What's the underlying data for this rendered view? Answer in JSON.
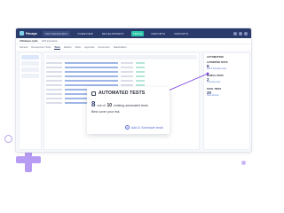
{
  "app": {
    "brand": "Panaya",
    "project": "SAP S4HANA RFC"
  },
  "nav": {
    "items": [
      "OVERVIEW",
      "DEVELOPMENT",
      "TESTS",
      "REPORTS",
      "REPORTS"
    ],
    "active": "TESTS"
  },
  "breadcrumb": {
    "cycle": "3 Release cycle",
    "desc": "UAT scenarios"
  },
  "tabs": [
    "General",
    "Development Tests",
    "Tests",
    "Defects",
    "Risks",
    "Approvals",
    "Documents",
    "Stakeholders"
  ],
  "right_panel": {
    "title": "AUTOMATION",
    "blocks": [
      {
        "label": "AUTOMATED TESTS",
        "number": "8",
        "link": "Add & Schedule tests"
      },
      {
        "label": "MANUAL TESTS",
        "number": "2",
        "link": "Automate tests"
      },
      {
        "label": "TOTAL TESTS",
        "number": "20",
        "link": "View all tests"
      }
    ]
  },
  "callout": {
    "title": "AUTOMATED TESTS",
    "count": "8",
    "out_of": "out of",
    "total": "10",
    "suffix": "existing automated tests",
    "subtitle": "Best cover your risk",
    "action": "Add & Schedule tests",
    "icon": "clipboard-icon",
    "action_icon": "plus-circle-icon"
  },
  "colors": {
    "nav_bg": "#2a3a6b",
    "active_tab": "#29c7a8",
    "accent": "#5b6fd8",
    "pointer": "#7b3fe0",
    "decor": "#b79cf3"
  }
}
